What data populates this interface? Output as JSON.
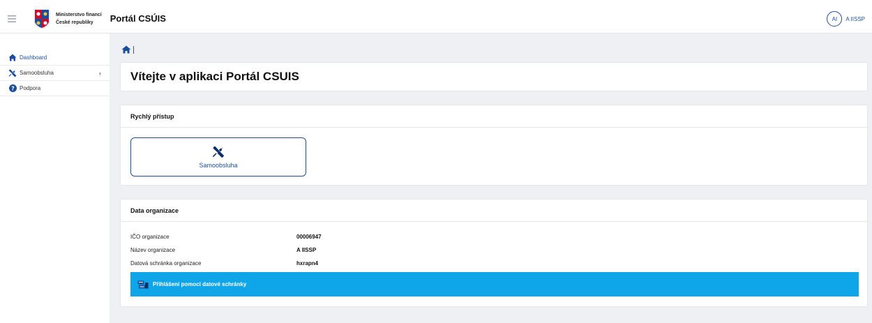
{
  "header": {
    "ministry_line1": "Ministerstvo financí",
    "ministry_line2": "České republiky",
    "app_title": "Portál CSÚIS",
    "user_initials": "AI",
    "user_name": "A IISSP"
  },
  "sidebar": {
    "items": [
      {
        "label": "Dashboard",
        "icon": "home-icon"
      },
      {
        "label": "Samoobsluha",
        "icon": "tools-icon",
        "chevron": "‹"
      },
      {
        "label": "Podpora",
        "icon": "help-icon"
      }
    ]
  },
  "main": {
    "welcome_title": "Vítejte v aplikaci Portál CSUIS",
    "quick_access": {
      "title": "Rychlý přístup",
      "button_label": "Samoobsluha"
    },
    "org_data": {
      "title": "Data organizace",
      "rows": [
        {
          "label": "IČO organizace",
          "value": "00006947"
        },
        {
          "label": "Název organizace",
          "value": "A IISSP"
        },
        {
          "label": "Datová schránka organizace",
          "value": "hxrapn4"
        }
      ],
      "login_button": "Přihlášení pomocí datové schránky"
    }
  },
  "colors": {
    "accent": "#1a4e9c",
    "cta": "#0ea5e9",
    "background": "#eef0f3"
  }
}
